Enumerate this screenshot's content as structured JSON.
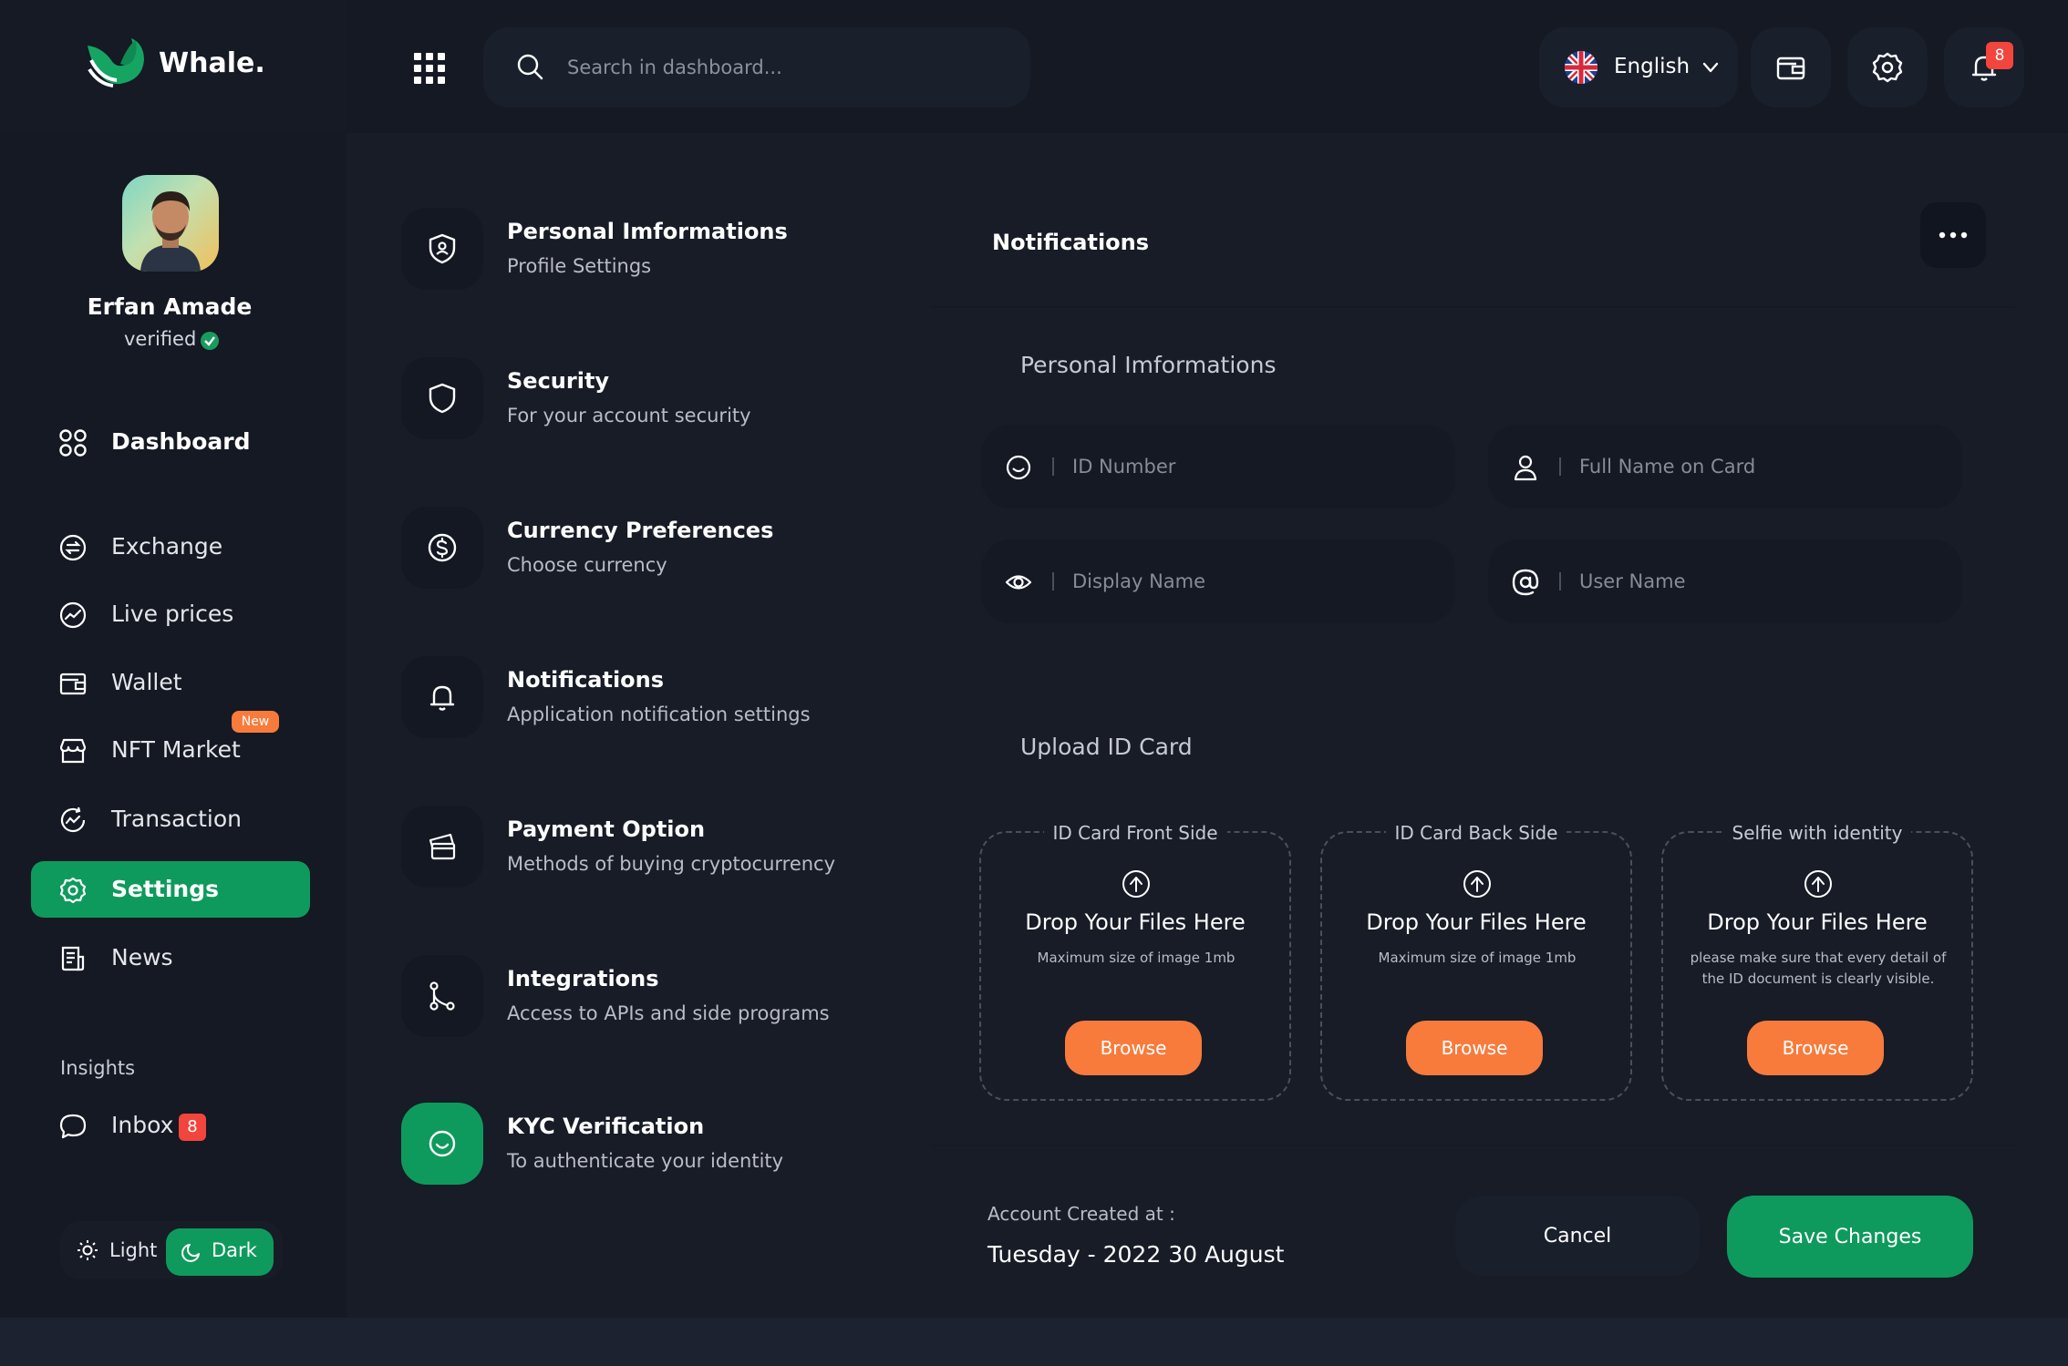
{
  "app": {
    "name": "Whale."
  },
  "search": {
    "placeholder": "Search in dashboard..."
  },
  "language": {
    "selected": "English"
  },
  "notifications": {
    "count": "8"
  },
  "user": {
    "name": "Erfan Amade",
    "status": "verified"
  },
  "sidebar": {
    "items": [
      {
        "label": "Dashboard"
      },
      {
        "label": "Exchange"
      },
      {
        "label": "Live prices"
      },
      {
        "label": "Wallet"
      },
      {
        "label": "NFT Market",
        "badge": "New"
      },
      {
        "label": "Transaction"
      },
      {
        "label": "Settings"
      },
      {
        "label": "News"
      }
    ],
    "insights_label": "Insights",
    "inbox": {
      "label": "Inbox",
      "count": "8"
    },
    "theme": {
      "light": "Light",
      "dark": "Dark"
    }
  },
  "settings_menu": [
    {
      "title": "Personal Imformations",
      "subtitle": "Profile Settings",
      "icon": "user-shield-icon"
    },
    {
      "title": "Security",
      "subtitle": "For your account security",
      "icon": "shield-icon"
    },
    {
      "title": "Currency Preferences",
      "subtitle": "Choose currency",
      "icon": "dollar-circle-icon"
    },
    {
      "title": "Notifications",
      "subtitle": "Application notification settings",
      "icon": "bell-icon"
    },
    {
      "title": "Payment Option",
      "subtitle": "Methods of buying cryptocurrency",
      "icon": "card-icon"
    },
    {
      "title": "Integrations",
      "subtitle": "Access to APIs and side programs",
      "icon": "branch-icon"
    },
    {
      "title": "KYC Verification",
      "subtitle": "To authenticate your identity",
      "icon": "smile-icon"
    }
  ],
  "panel": {
    "title": "Notifications",
    "personal_label": "Personal Imformations",
    "fields": {
      "id_number": "ID Number",
      "full_name": "Full Name on Card",
      "display_name": "Display Name",
      "user_name": "User Name"
    },
    "upload_label": "Upload ID Card",
    "uploads": [
      {
        "title": "ID Card Front Side",
        "drop": "Drop Your Files Here",
        "note": "Maximum size of image 1mb",
        "button": "Browse"
      },
      {
        "title": "ID Card Back Side",
        "drop": "Drop Your Files Here",
        "note": "Maximum size of image 1mb",
        "button": "Browse"
      },
      {
        "title": "Selfie with identity",
        "drop": "Drop Your Files Here",
        "note": "please make sure that every detail of the ID document is clearly visible.",
        "button": "Browse"
      }
    ],
    "account_created_label": "Account Created at :",
    "account_created_date": "Tuesday - 2022 30 August",
    "cancel_label": "Cancel",
    "save_label": "Save Changes"
  },
  "colors": {
    "accent": "#0f9a5d",
    "orange": "#f87b3c",
    "badge": "#f1453d",
    "background": "#171c27"
  }
}
